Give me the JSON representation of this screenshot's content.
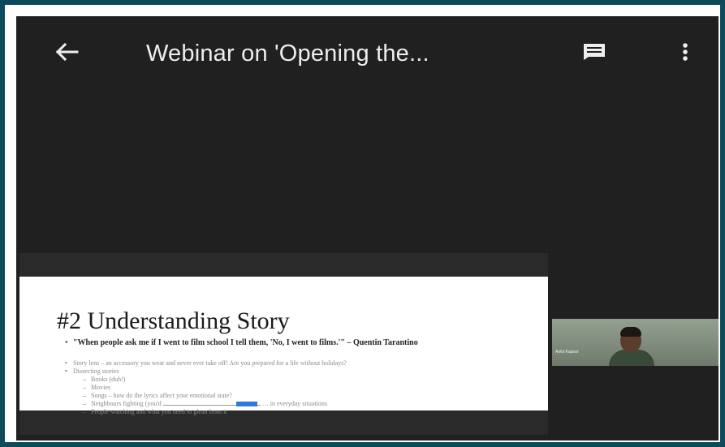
{
  "topbar": {
    "title": "Webinar on 'Opening the...",
    "back_icon": "arrow-left-icon",
    "captions_icon": "captions-icon",
    "more_icon": "more-vert-icon"
  },
  "slide": {
    "title": "#2 Understanding Story",
    "quote": "\"When people ask me if I went to film school I tell them, 'No, I went to films.'\" – Quentin Tarantino",
    "bullets": [
      {
        "text": "Story lens – an accessory you wear and never ever take off! Are you prepared for a life without holidays?",
        "level": 1
      },
      {
        "text": "Dissecting stories",
        "level": 1
      },
      {
        "text": "Books (duh!)",
        "level": 2
      },
      {
        "text": "Movies",
        "level": 2
      },
      {
        "text": "Songs – how do the lyrics affect your emotional state?",
        "level": 2
      },
      {
        "text": "Neighbours fighting (you'd",
        "suffix": "… in everyday situations",
        "level": 2
      },
      {
        "text": "People-watching and what you need to glean from it",
        "level": 2
      }
    ]
  },
  "participant": {
    "name": "Ankit Kapoor"
  },
  "colors": {
    "outer_border": "#0e4b5a",
    "screen_bg": "#202020",
    "text_primary": "#eeeeee",
    "accent_selection": "#2f7ad8"
  }
}
